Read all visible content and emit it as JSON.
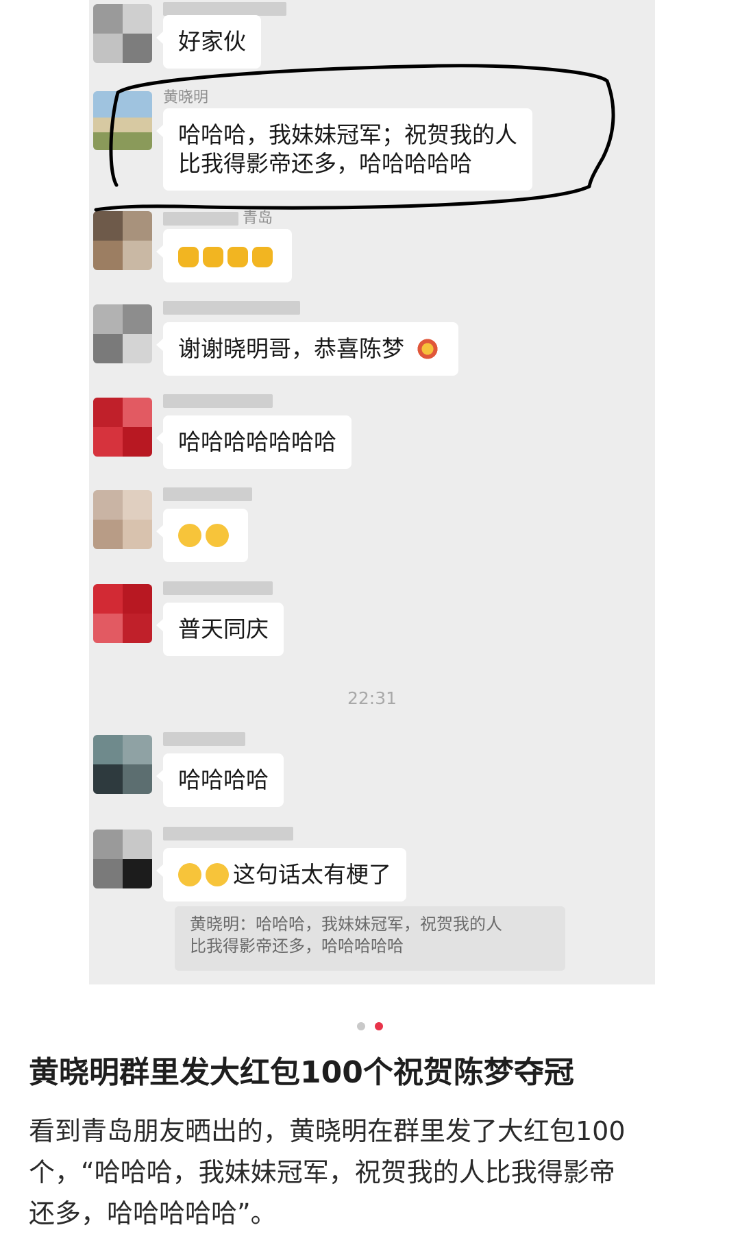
{
  "chat": {
    "messages": [
      {
        "sender": "",
        "text": "好家伙"
      },
      {
        "sender": "黄晓明",
        "text_lines": [
          "哈哈哈，我妹妹冠军；祝贺我的人",
          "比我得影帝还多，哈哈哈哈哈"
        ]
      },
      {
        "sender": "青岛",
        "emoji": [
          "thumbs-up",
          "thumbs-up",
          "thumbs-up",
          "thumbs-up"
        ]
      },
      {
        "sender": "",
        "text": "谢谢晓明哥，恭喜陈梦",
        "emoji": [
          "fireworks"
        ]
      },
      {
        "sender": "",
        "text": "哈哈哈哈哈哈哈"
      },
      {
        "sender": "",
        "emoji": [
          "laughing-crying",
          "laughing-crying"
        ]
      },
      {
        "sender": "",
        "text": "普天同庆"
      },
      {
        "sender": "",
        "text": "哈哈哈哈"
      },
      {
        "sender": "",
        "text": "这句话太有梗了",
        "emoji": [
          "laughing",
          "laughing"
        ]
      }
    ],
    "timestamp": "22:31",
    "quote": {
      "lines": [
        "黄晓明：哈哈哈，我妹妹冠军，祝贺我的人",
        "比我得影帝还多，哈哈哈哈哈"
      ]
    }
  },
  "carousel": {
    "count": 2,
    "active": 2,
    "colors": {
      "inactive": "#c9c9c9",
      "active": "#e8344a"
    }
  },
  "article": {
    "title": "黄晓明群里发大红包100个祝贺陈梦夺冠",
    "body_lines": [
      "看到青岛朋友晒出的，黄晓明在群里发了大红包100",
      "个，“哈哈哈，我妹妹冠军，祝贺我的人比我得影帝",
      "还多，哈哈哈哈哈”。"
    ]
  },
  "colors": {
    "chat_bg": "#ededed",
    "bubble": "#ffffff",
    "annotation": "#000000"
  }
}
